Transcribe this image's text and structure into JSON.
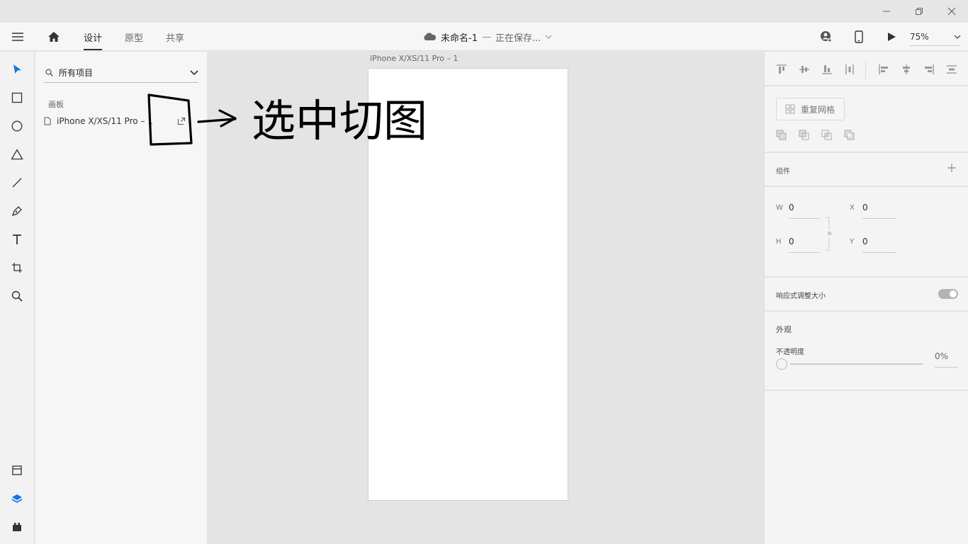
{
  "window": {
    "minimize_icon": "minimize-icon",
    "maximize_icon": "restore-icon",
    "close_icon": "close-icon"
  },
  "toolbar": {
    "tabs": {
      "design": "设计",
      "prototype": "原型",
      "share": "共享"
    },
    "document": {
      "name": "未命名-1",
      "separator": "—",
      "status": "正在保存..."
    },
    "zoom": "75%"
  },
  "layers": {
    "search_label": "所有项目",
    "section_label": "画板",
    "artboards": [
      {
        "name": "iPhone X/XS/11 Pro – 1"
      }
    ]
  },
  "canvas": {
    "artboard_title": "iPhone X/XS/11 Pro – 1",
    "annotation": "选中切图"
  },
  "props": {
    "repeat_grid_label": "重复网格",
    "components_label": "组件",
    "dims": {
      "w_key": "W",
      "w": "0",
      "x_key": "X",
      "x": "0",
      "h_key": "H",
      "h": "0",
      "y_key": "Y",
      "y": "0"
    },
    "responsive_label": "响应式调整大小",
    "appearance_label": "外观",
    "opacity_label": "不透明度",
    "opacity_value": "0%"
  },
  "colors": {
    "accent": "#1473e6",
    "canvas": "#e4e4e4",
    "panel": "#f6f6f6",
    "ink": "#000000"
  }
}
